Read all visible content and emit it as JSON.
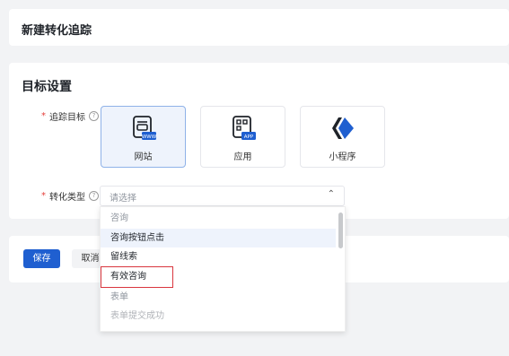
{
  "header": {
    "title": "新建转化追踪"
  },
  "settings": {
    "section_title": "目标设置",
    "track_target": {
      "required_mark": "*",
      "label": "追踪目标",
      "help": "?",
      "options": [
        {
          "label": "网站",
          "icon": "web-page-icon",
          "badge": "WWW",
          "selected": true
        },
        {
          "label": "应用",
          "icon": "app-icon",
          "badge": "APP",
          "selected": false
        },
        {
          "label": "小程序",
          "icon": "mini-program-icon",
          "selected": false
        }
      ]
    },
    "conversion_type": {
      "required_mark": "*",
      "label": "转化类型",
      "help": "?",
      "placeholder": "请选择",
      "caret": "⌃"
    }
  },
  "actions": {
    "save_label": "保存",
    "cancel_label": "取消"
  },
  "dropdown": {
    "options": [
      {
        "label": "咨询",
        "kind": "group"
      },
      {
        "label": "咨询按钮点击",
        "kind": "option",
        "highlighted": true
      },
      {
        "label": "留线索",
        "kind": "option"
      },
      {
        "label": "有效咨询",
        "kind": "option",
        "boxed": true
      },
      {
        "label": "表单",
        "kind": "group"
      },
      {
        "label": "表单提交成功",
        "kind": "option",
        "disabled": true
      }
    ]
  },
  "colors": {
    "primary": "#1f5fd0",
    "required": "#e5403b",
    "highlight_box": "#d9363e",
    "selected_bg": "#eef3fc"
  }
}
